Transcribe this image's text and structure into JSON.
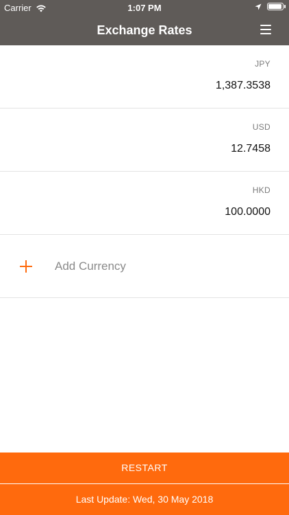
{
  "status_bar": {
    "carrier": "Carrier",
    "time": "1:07 PM",
    "icons": [
      "wifi-icon",
      "location-arrow-icon",
      "battery-icon"
    ],
    "battery_level": 1.0
  },
  "navbar": {
    "title": "Exchange Rates",
    "menu_icon": "hamburger-menu-icon"
  },
  "rates": [
    {
      "code": "JPY",
      "amount": "1,387.3538"
    },
    {
      "code": "USD",
      "amount": "12.7458"
    },
    {
      "code": "HKD",
      "amount": "100.0000"
    }
  ],
  "add_currency": {
    "label": "Add Currency",
    "icon": "plus-icon"
  },
  "footer": {
    "restart_label": "RESTART",
    "last_update": "Last Update: Wed, 30 May 2018"
  },
  "colors": {
    "nav_background": "#5f5b58",
    "accent": "#ff6a0d",
    "text_primary": "#111111",
    "text_secondary": "#7a7a7a",
    "separator": "#e3e3e3"
  }
}
